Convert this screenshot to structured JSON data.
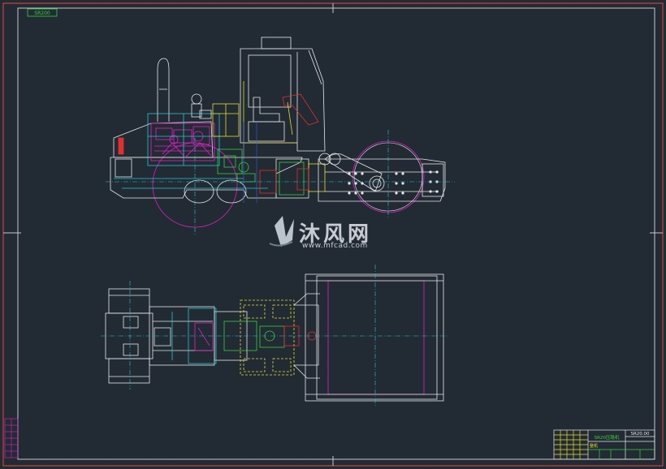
{
  "drawing": {
    "code_tag": "SR200",
    "title_block": {
      "name": "SR20压路机",
      "code": "SR20.00",
      "sub_label": "整机"
    }
  },
  "watermark": {
    "cn_text": "沐风网",
    "url_text": "www.mfcad.com"
  },
  "colors": {
    "background": "#222a33",
    "frame": "#c8c8c8",
    "outer_border": "#d04040",
    "white": "#e8e8e8",
    "cyan": "#27c6d6",
    "magenta": "#e020c8",
    "yellow": "#e8e030",
    "green": "#38d040",
    "red": "#e03030",
    "blue": "#3a5ef0",
    "orange": "#e07020"
  }
}
